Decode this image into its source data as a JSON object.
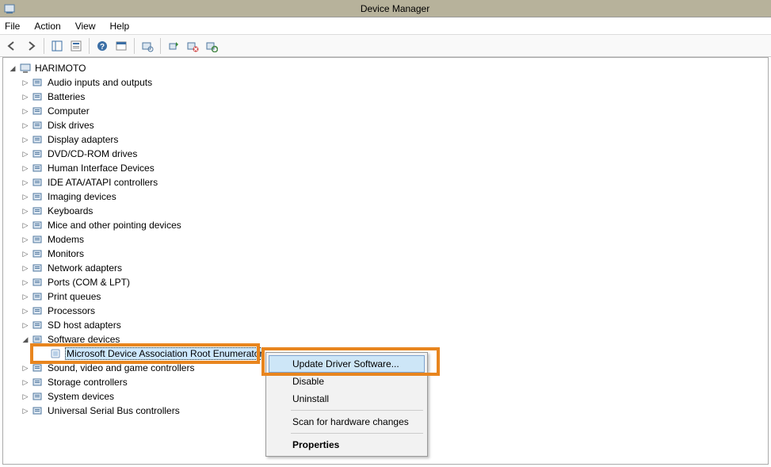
{
  "window": {
    "title": "Device Manager"
  },
  "menu": {
    "file": "File",
    "action": "Action",
    "view": "View",
    "help": "Help"
  },
  "tree": {
    "root": "HARIMOTO",
    "categories": [
      {
        "label": "Audio inputs and outputs",
        "expanded": false
      },
      {
        "label": "Batteries",
        "expanded": false
      },
      {
        "label": "Computer",
        "expanded": false
      },
      {
        "label": "Disk drives",
        "expanded": false
      },
      {
        "label": "Display adapters",
        "expanded": false
      },
      {
        "label": "DVD/CD-ROM drives",
        "expanded": false
      },
      {
        "label": "Human Interface Devices",
        "expanded": false
      },
      {
        "label": "IDE ATA/ATAPI controllers",
        "expanded": false
      },
      {
        "label": "Imaging devices",
        "expanded": false
      },
      {
        "label": "Keyboards",
        "expanded": false
      },
      {
        "label": "Mice and other pointing devices",
        "expanded": false
      },
      {
        "label": "Modems",
        "expanded": false
      },
      {
        "label": "Monitors",
        "expanded": false
      },
      {
        "label": "Network adapters",
        "expanded": false
      },
      {
        "label": "Ports (COM & LPT)",
        "expanded": false
      },
      {
        "label": "Print queues",
        "expanded": false
      },
      {
        "label": "Processors",
        "expanded": false
      },
      {
        "label": "SD host adapters",
        "expanded": false
      },
      {
        "label": "Software devices",
        "expanded": true,
        "children": [
          {
            "label": "Microsoft Device Association Root Enumerator",
            "selected": true
          }
        ]
      },
      {
        "label": "Sound, video and game controllers",
        "expanded": false
      },
      {
        "label": "Storage controllers",
        "expanded": false
      },
      {
        "label": "System devices",
        "expanded": false
      },
      {
        "label": "Universal Serial Bus controllers",
        "expanded": false
      }
    ]
  },
  "context_menu": {
    "update": "Update Driver Software...",
    "disable": "Disable",
    "uninstall": "Uninstall",
    "scan": "Scan for hardware changes",
    "properties": "Properties"
  },
  "icons": {
    "back": "back-icon",
    "forward": "forward-icon",
    "up": "up-icon",
    "console": "console-tree-icon",
    "help": "help-icon",
    "props": "properties-icon",
    "scan": "scan-hw-icon",
    "update": "update-driver-icon",
    "disable": "disable-icon",
    "uninstall": "uninstall-icon"
  }
}
